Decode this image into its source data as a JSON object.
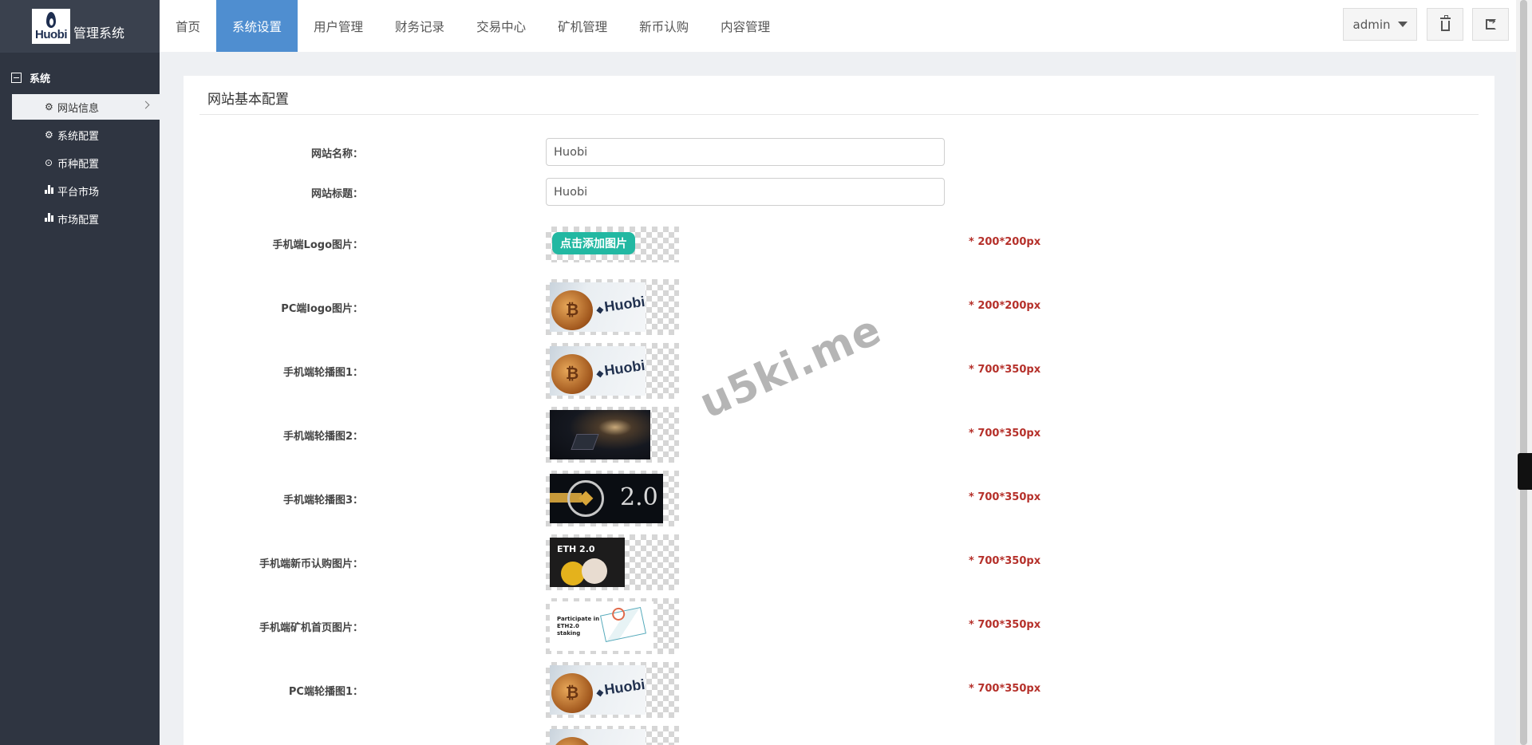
{
  "brand": {
    "logo_word": "Huobi",
    "title": "管理系统"
  },
  "nav": {
    "tabs": [
      {
        "label": "首页",
        "active": false
      },
      {
        "label": "系统设置",
        "active": true
      },
      {
        "label": "用户管理",
        "active": false
      },
      {
        "label": "财务记录",
        "active": false
      },
      {
        "label": "交易中心",
        "active": false
      },
      {
        "label": "矿机管理",
        "active": false
      },
      {
        "label": "新币认购",
        "active": false
      },
      {
        "label": "内容管理",
        "active": false
      }
    ],
    "user": "admin",
    "active_color": "#4f8ed0"
  },
  "sidebar": {
    "group": "系统",
    "items": [
      {
        "label": "网站信息",
        "icon": "gear-icon",
        "active": true
      },
      {
        "label": "系统配置",
        "icon": "gear-icon",
        "active": false
      },
      {
        "label": "币种配置",
        "icon": "circle-dot-icon",
        "active": false
      },
      {
        "label": "平台市场",
        "icon": "bar-chart-icon",
        "active": false
      },
      {
        "label": "市场配置",
        "icon": "bar-chart-icon",
        "active": false
      }
    ]
  },
  "panel": {
    "title": "网站基本配置",
    "fields": {
      "site_name": {
        "label": "网站名称：",
        "value": "Huobi"
      },
      "site_title": {
        "label": "网站标题：",
        "value": "Huobi"
      }
    },
    "image_rows": [
      {
        "label": "手机端Logo图片：",
        "note": "* 200*200px",
        "button": "点击添加图片"
      },
      {
        "label": "PC端logo图片：",
        "note": "* 200*200px",
        "thumb_text": "Huobi"
      },
      {
        "label": "手机端轮播图1：",
        "note": "* 700*350px",
        "thumb_text": "Huobi"
      },
      {
        "label": "手机端轮播图2：",
        "note": "* 700*350px"
      },
      {
        "label": "手机端轮播图3：",
        "note": "* 700*350px",
        "thumb_text": "2.0"
      },
      {
        "label": "手机端新币认购图片：",
        "note": "* 700*350px",
        "thumb_text": "ETH 2.0"
      },
      {
        "label": "手机端矿机首页图片：",
        "note": "* 700*350px",
        "thumb_text": "Participate in ETH2.0 staking"
      },
      {
        "label": "PC端轮播图1：",
        "note": "* 700*350px",
        "thumb_text": "Huobi"
      }
    ],
    "note_color": "#b5302a"
  },
  "watermark": "u5ki.me"
}
